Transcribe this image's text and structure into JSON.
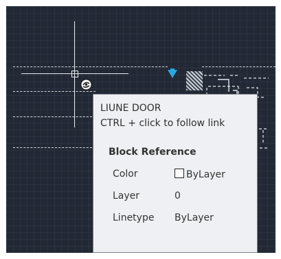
{
  "tooltip": {
    "title": "LIUNE DOOR",
    "hint": "CTRL + click to follow link",
    "section": "Block Reference",
    "properties": [
      {
        "label": "Color",
        "value": "ByLayer",
        "swatch": "#ffffff"
      },
      {
        "label": "Layer",
        "value": "0"
      },
      {
        "label": "Linetype",
        "value": "ByLayer"
      }
    ]
  },
  "canvas": {
    "background": "#222834",
    "grip_color": "#27a8e0",
    "crosshair_color": "#e9ecef",
    "icons": [
      "hyperlink-cursor-icon",
      "grip-icon",
      "hatch-pattern"
    ]
  }
}
